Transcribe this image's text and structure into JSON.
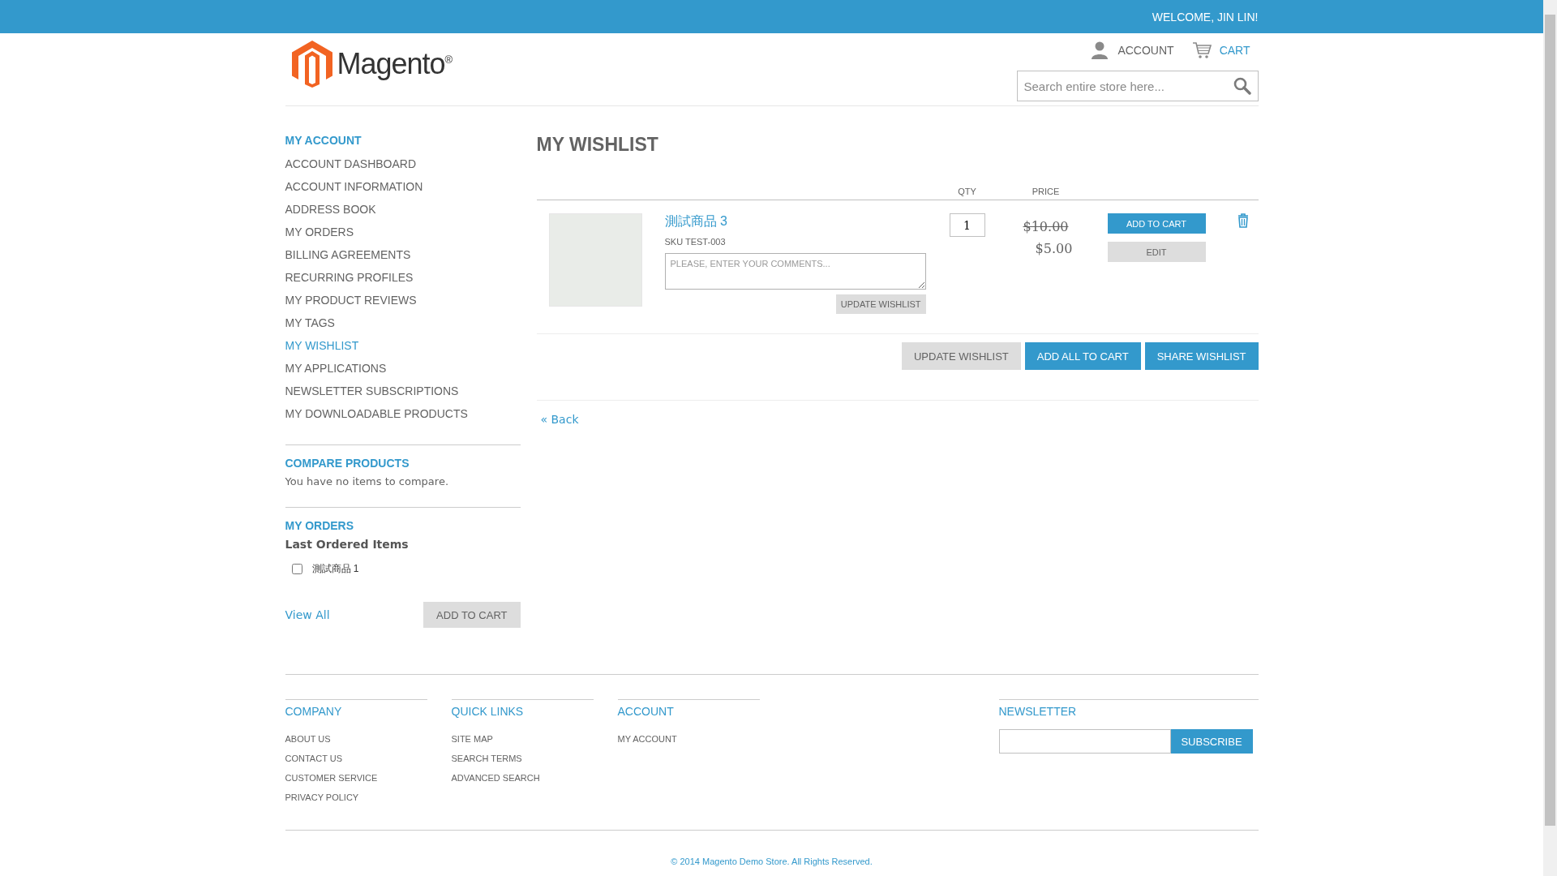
{
  "top_bar": {
    "welcome": "WELCOME, JIN LIN!"
  },
  "header": {
    "logo_text": "Magento",
    "logo_mark": "®",
    "account": "ACCOUNT",
    "cart": "CART",
    "search": {
      "placeholder": "Search entire store here..."
    }
  },
  "sidebar": {
    "title": "MY ACCOUNT",
    "items": [
      {
        "label": "ACCOUNT DASHBOARD",
        "selected": false
      },
      {
        "label": "ACCOUNT INFORMATION",
        "selected": false
      },
      {
        "label": "ADDRESS BOOK",
        "selected": false
      },
      {
        "label": "MY ORDERS",
        "selected": false
      },
      {
        "label": "BILLING AGREEMENTS",
        "selected": false
      },
      {
        "label": "RECURRING PROFILES",
        "selected": false
      },
      {
        "label": "MY PRODUCT REVIEWS",
        "selected": false
      },
      {
        "label": "MY TAGS",
        "selected": false
      },
      {
        "label": "MY WISHLIST",
        "selected": true
      },
      {
        "label": "MY APPLICATIONS",
        "selected": false
      },
      {
        "label": "NEWSLETTER SUBSCRIPTIONS",
        "selected": false
      },
      {
        "label": "MY DOWNLOADABLE PRODUCTS",
        "selected": false
      }
    ],
    "compare": {
      "title": "COMPARE PRODUCTS",
      "message": "You have no items to compare."
    },
    "orders": {
      "title": "MY ORDERS",
      "subtitle": "Last Ordered Items",
      "items": [
        {
          "name": "測試商品 1",
          "checked": false
        }
      ],
      "view_all": "View All",
      "add_to_cart": "ADD TO CART"
    }
  },
  "wishlist": {
    "title": "MY WISHLIST",
    "columns": [
      "QTY",
      "PRICE"
    ],
    "items": [
      {
        "name": "測試商品 3",
        "sku": "SKU TEST-003",
        "comment_placeholder": "PLEASE, ENTER YOUR COMMENTS...",
        "update_button": "UPDATE WISHLIST",
        "qty": "1",
        "old_price": "$10.00",
        "price": "$5.00",
        "add_to_cart": "ADD TO CART",
        "edit": "EDIT"
      }
    ],
    "buttons": [
      {
        "label": "UPDATE WISHLIST",
        "kind": "secondary"
      },
      {
        "label": "ADD ALL TO CART",
        "kind": "primary"
      },
      {
        "label": "SHARE WISHLIST",
        "kind": "primary"
      }
    ],
    "back": "« Back"
  },
  "footer": {
    "columns": [
      {
        "title": "COMPANY",
        "links": [
          "ABOUT US",
          "CONTACT US",
          "CUSTOMER SERVICE",
          "PRIVACY POLICY"
        ]
      },
      {
        "title": "QUICK LINKS",
        "links": [
          "SITE MAP",
          "SEARCH TERMS",
          "ADVANCED SEARCH"
        ]
      },
      {
        "title": "ACCOUNT",
        "links": [
          "MY ACCOUNT"
        ]
      }
    ],
    "newsletter": {
      "title": "NEWSLETTER",
      "button": "SUBSCRIBE"
    },
    "copyright": "© 2014 Magento Demo Store. All Rights Reserved."
  }
}
